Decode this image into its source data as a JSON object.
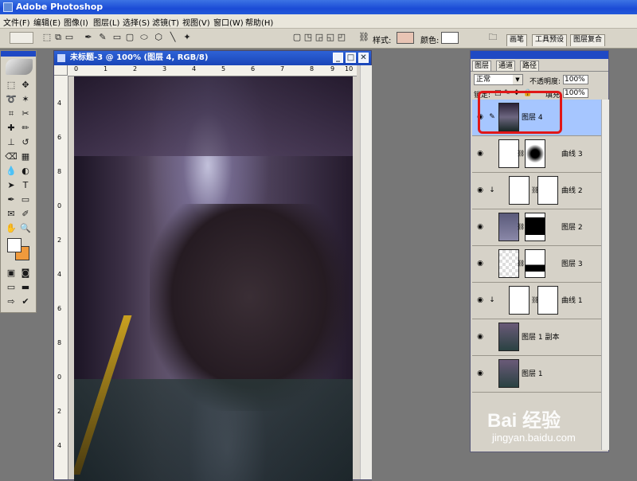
{
  "app": {
    "title": "Adobe Photoshop"
  },
  "menubar": {
    "items": [
      "文件(F)",
      "编辑(E)",
      "图像(I)",
      "图层(L)",
      "选择(S)",
      "滤镜(T)",
      "视图(V)",
      "窗口(W)",
      "帮助(H)"
    ]
  },
  "options_bar": {
    "style_label": "样式:",
    "color_label": "颜色:",
    "wells": [
      "画笔",
      "工具预设",
      "图层复合"
    ]
  },
  "document": {
    "title": "未标题-3 @ 100% (图层 4, RGB/8)",
    "ruler_top_marks": [
      "0",
      "1",
      "2",
      "3",
      "4",
      "5",
      "6",
      "7",
      "8",
      "9",
      "10"
    ],
    "ruler_left_marks": [
      "4",
      "6",
      "8",
      "0",
      "2",
      "4",
      "6",
      "8",
      "0",
      "2",
      "4"
    ]
  },
  "layers_panel": {
    "tabs": [
      "图层",
      "通道",
      "路径"
    ],
    "blend_mode": "正常",
    "opacity_label": "不透明度:",
    "opacity_value": "100%",
    "lock_label": "锁定:",
    "fill_label": "填充:",
    "fill_value": "100%",
    "layers": [
      {
        "name": "图层 4",
        "selected": true
      },
      {
        "name": "曲线 3",
        "selected": false
      },
      {
        "name": "曲线 2",
        "selected": false
      },
      {
        "name": "图层 2",
        "selected": false
      },
      {
        "name": "图层 3",
        "selected": false
      },
      {
        "name": "曲线 1",
        "selected": false
      },
      {
        "name": "图层 1 副本",
        "selected": false
      },
      {
        "name": "图层 1",
        "selected": false
      }
    ]
  },
  "watermark": {
    "logo": "Bai 经验",
    "subtitle": "jingyan.baidu.com"
  },
  "colors": {
    "foreground": "#ffffff",
    "background": "#f09a3c",
    "highlight": "#e01717",
    "selected_layer": "#a6c6ff"
  }
}
